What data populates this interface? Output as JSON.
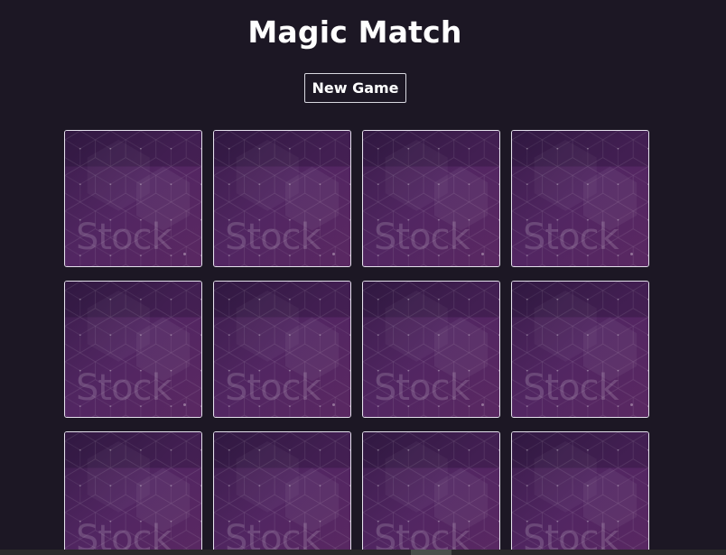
{
  "game": {
    "title": "Magic Match",
    "new_game_label": "New Game"
  },
  "colors": {
    "background": "#1c1724",
    "card_back": "#4b2457",
    "card_border": "#e4e0ec",
    "text": "#ffffff"
  },
  "cards": [
    {
      "watermark": "Stock",
      "state": "face-down"
    },
    {
      "watermark": "Stock",
      "state": "face-down"
    },
    {
      "watermark": "Stock",
      "state": "face-down"
    },
    {
      "watermark": "Stock",
      "state": "face-down"
    },
    {
      "watermark": "Stock",
      "state": "face-down"
    },
    {
      "watermark": "Stock",
      "state": "face-down"
    },
    {
      "watermark": "Stock",
      "state": "face-down"
    },
    {
      "watermark": "Stock",
      "state": "face-down"
    },
    {
      "watermark": "Stock",
      "state": "face-down"
    },
    {
      "watermark": "Stock",
      "state": "face-down"
    },
    {
      "watermark": "Stock",
      "state": "face-down"
    },
    {
      "watermark": "Stock",
      "state": "face-down"
    }
  ]
}
